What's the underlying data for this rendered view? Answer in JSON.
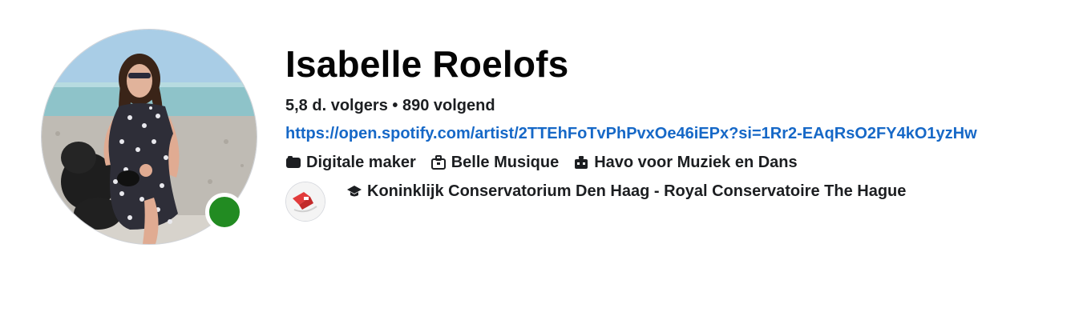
{
  "profile": {
    "name": "Isabelle Roelofs",
    "followers": "5,8 d. volgers",
    "separator": "•",
    "following": "890 volgend",
    "link": "https://open.spotify.com/artist/2TTEhFoTvPhPvxOe46iEPx?si=1Rr2-EAqRsO2FY4kO1yzHw",
    "online": true
  },
  "tags": [
    {
      "icon": "category-icon",
      "label": "Digitale maker"
    },
    {
      "icon": "briefcase-icon",
      "label": "Belle Musique"
    },
    {
      "icon": "work-icon",
      "label": "Havo voor Muziek en Dans"
    }
  ],
  "education": {
    "icon": "graduation-cap-icon",
    "label": "Koninklijk Conservatorium Den Haag - Royal Conservatoire The Hague"
  },
  "colors": {
    "link": "#1668c7",
    "online": "#228b22",
    "text": "#050505"
  }
}
